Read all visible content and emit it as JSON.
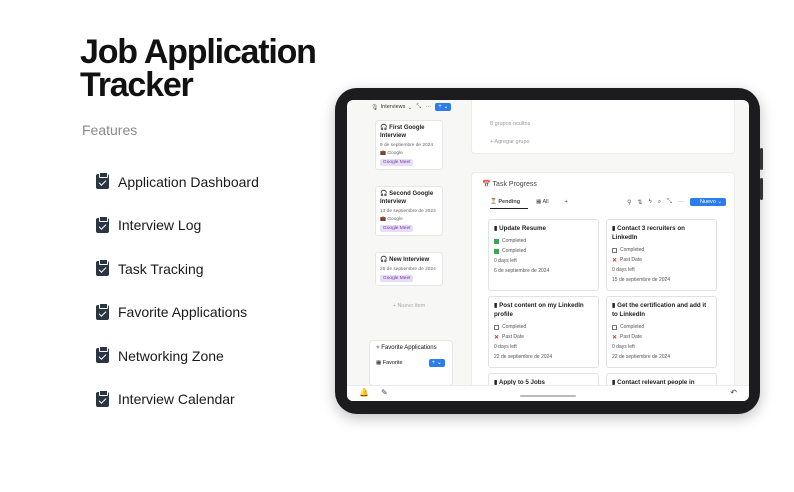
{
  "hero": {
    "title": "Job Application Tracker"
  },
  "features": {
    "title": "Features",
    "items": [
      "Application Dashboard",
      "Interview Log",
      "Task Tracking",
      "Favorite Applications",
      "Networking Zone",
      "Interview Calendar"
    ]
  },
  "app": {
    "interviews_header": "Interviews",
    "interview_cards": [
      {
        "title": "First Google Interview",
        "date": "9 de septiembre de 2024",
        "company": "Google",
        "tag": "Google Meet"
      },
      {
        "title": "Second Google Interview",
        "date": "13 de septiembre de 2024",
        "company": "Google",
        "tag": "Google Meet"
      },
      {
        "title": "New Interview",
        "date": "25 de septiembre de 2024",
        "company": "",
        "tag": "Google Meet"
      }
    ],
    "new_item": "+ Nuevo item",
    "favorite": {
      "title": "Favorite Applications",
      "view": "Favorite"
    },
    "hidden_groups": "8 grupos ocultos",
    "add_group": "+ Agregar grupo",
    "task_progress": {
      "title": "Task Progress",
      "tabs": [
        "Pending",
        "All"
      ],
      "new_button": "Nuevo",
      "cards": [
        {
          "title": "Update Resume",
          "lines": [
            [
              "on",
              "Completed"
            ],
            [
              "on",
              "Completed"
            ]
          ],
          "days": "0 days left",
          "date": "6 de septiembre de 2024"
        },
        {
          "title": "Contact 3 recruiters on LinkedIn",
          "lines": [
            [
              "off",
              "Completed"
            ],
            [
              "x",
              "Past Date"
            ]
          ],
          "days": "0 days left",
          "date": "15 de septiembre de 2024"
        },
        {
          "title": "Post content on my LinkedIn profile",
          "lines": [
            [
              "off",
              "Completed"
            ],
            [
              "x",
              "Past Date"
            ]
          ],
          "days": "0 days left",
          "date": "22 de septiembre de 2024"
        },
        {
          "title": "Get the certification and add it to LinkedIn",
          "lines": [
            [
              "off",
              "Completed"
            ],
            [
              "x",
              "Past Date"
            ]
          ],
          "days": "0 days left",
          "date": "22 de septiembre de 2024"
        },
        {
          "title": "Apply to 5 Jobs",
          "lines": [],
          "days": "",
          "date": ""
        },
        {
          "title": "Contact relevant people in",
          "lines": [],
          "days": "",
          "date": ""
        }
      ]
    }
  }
}
